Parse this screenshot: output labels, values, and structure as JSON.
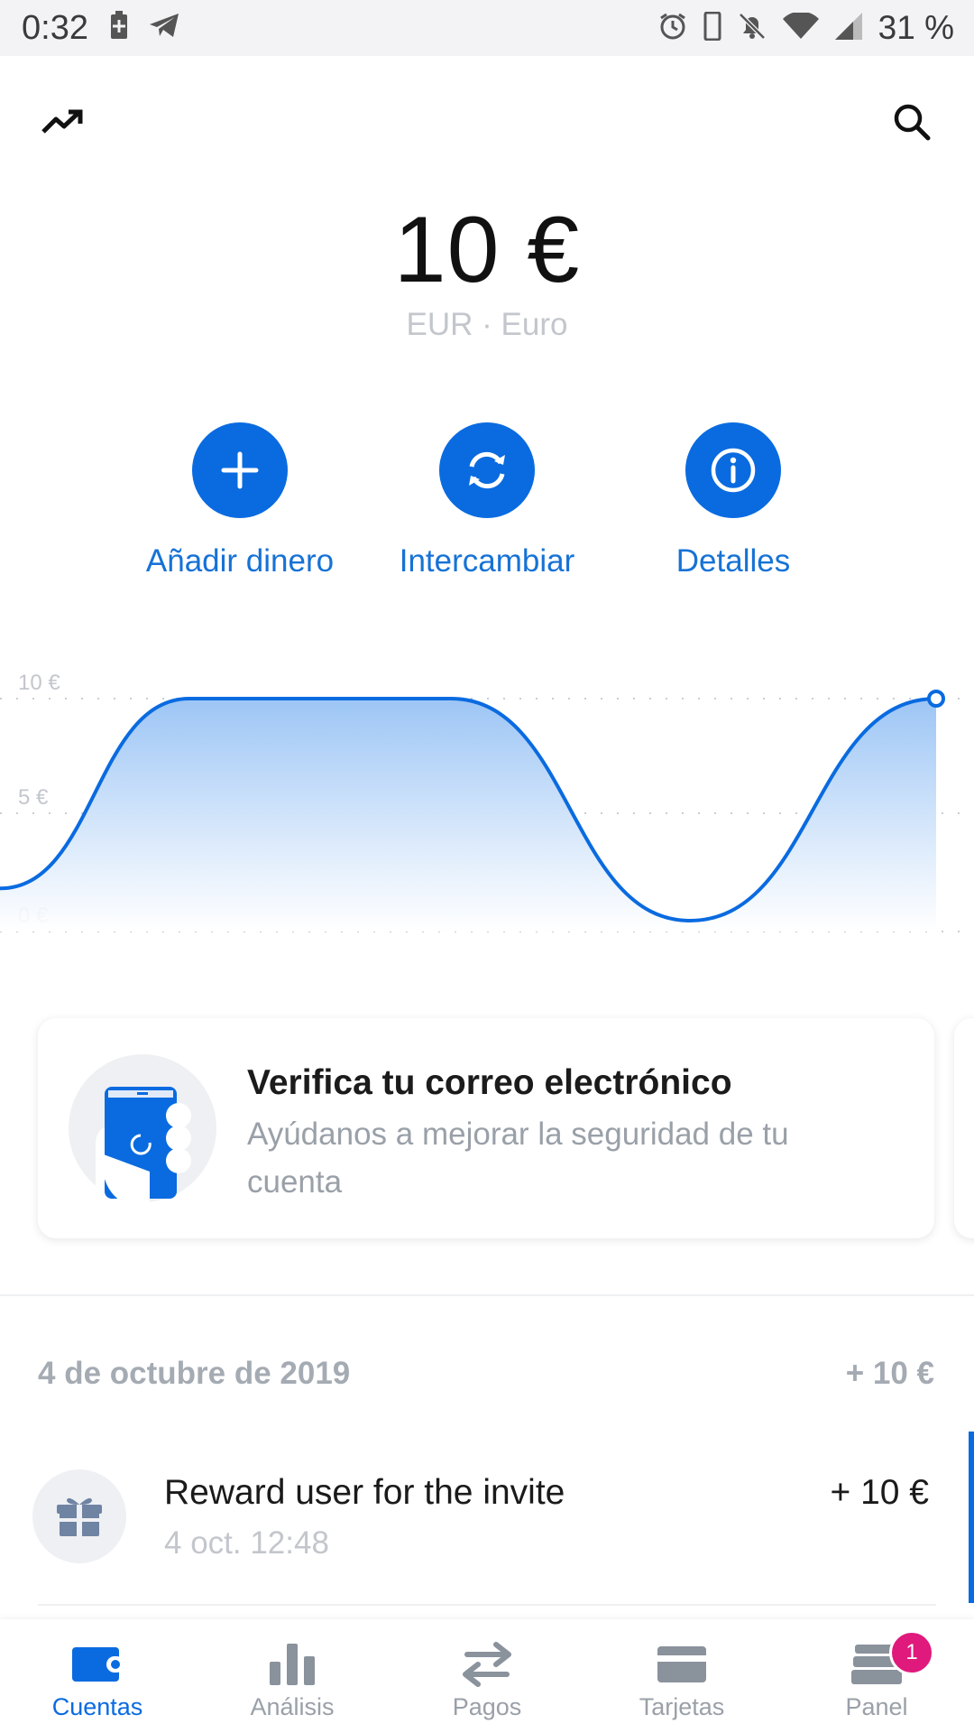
{
  "status_bar": {
    "time": "0:32",
    "battery_pct": "31 %",
    "icons_left": [
      "battery-saver-icon",
      "telegram-icon"
    ],
    "icons_right": [
      "alarm-icon",
      "phone-icon",
      "bell-off-icon",
      "wifi-icon",
      "signal-icon"
    ]
  },
  "header": {
    "left_icon": "trending-up-icon",
    "right_icon": "search-icon"
  },
  "account": {
    "balance": "10 €",
    "currency": "EUR · Euro"
  },
  "actions": [
    {
      "label": "Añadir dinero",
      "icon": "plus-icon"
    },
    {
      "label": "Intercambiar",
      "icon": "exchange-icon"
    },
    {
      "label": "Detalles",
      "icon": "info-icon"
    }
  ],
  "chart_data": {
    "type": "area",
    "y_tick_labels": [
      "10 €",
      "5 €",
      "0 €"
    ],
    "ylim": [
      0,
      10
    ],
    "grid": true,
    "series_color": "#0a6be0",
    "values": [
      1.5,
      10,
      10,
      10,
      0,
      10
    ]
  },
  "promo_card": {
    "title": "Verifica tu correo electrónico",
    "subtitle": "Ayúdanos a mejorar la seguridad de tu cuenta"
  },
  "transactions": {
    "date_header": "4 de octubre de 2019",
    "date_total": "+ 10 €",
    "items": [
      {
        "title": "Reward user for the invite",
        "time": "4 oct. 12:48",
        "amount": "+ 10 €",
        "icon": "gift-icon"
      }
    ]
  },
  "bottom_nav": [
    {
      "label": "Cuentas",
      "icon": "wallet-icon",
      "active": true
    },
    {
      "label": "Análisis",
      "icon": "bar-chart-icon",
      "active": false
    },
    {
      "label": "Pagos",
      "icon": "transfer-arrows-icon",
      "active": false
    },
    {
      "label": "Tarjetas",
      "icon": "card-icon",
      "active": false
    },
    {
      "label": "Panel",
      "icon": "panel-stack-icon",
      "active": false,
      "badge": "1"
    }
  ]
}
